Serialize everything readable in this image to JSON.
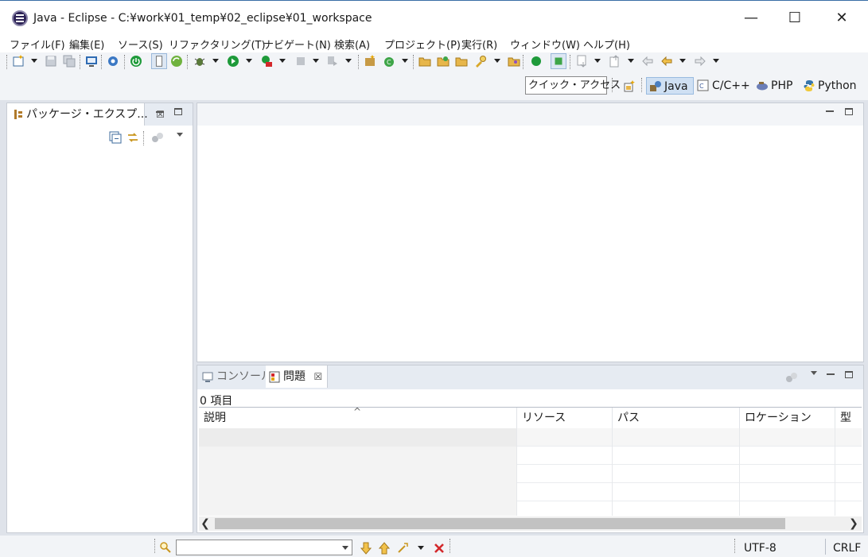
{
  "window": {
    "title": "Java - Eclipse - C:¥work¥01_temp¥02_eclipse¥01_workspace",
    "minimize_glyph": "—",
    "maximize_glyph": "☐",
    "close_glyph": "✕"
  },
  "menu": [
    "ファイル(F)",
    "編集(E)",
    "ソース(S)",
    "リファクタリング(T)",
    "ナビゲート(N)",
    "検索(A)",
    "プロジェクト(P)",
    "実行(R)",
    "ウィンドウ(W)",
    "ヘルプ(H)"
  ],
  "quick_access": {
    "label": "クイック・アクセス"
  },
  "perspectives": [
    {
      "label": "Java",
      "icon": "java-perspective-icon",
      "active": true
    },
    {
      "label": "C/C++",
      "icon": "cpp-perspective-icon",
      "active": false
    },
    {
      "label": "PHP",
      "icon": "php-perspective-icon",
      "active": false
    },
    {
      "label": "Python",
      "icon": "python-perspective-icon",
      "active": false
    }
  ],
  "left_view": {
    "tab_label": "パッケージ・エクスプ...",
    "close_glyph": "☒"
  },
  "bottom_view": {
    "tabs": [
      {
        "label": "コンソール",
        "active": false
      },
      {
        "label": "問題",
        "active": true
      }
    ],
    "close_glyph": "☒",
    "item_count": "0 項目",
    "columns": [
      "説明",
      "リソース",
      "パス",
      "ロケーション",
      "型"
    ],
    "sort_indicator": "^"
  },
  "status": {
    "encoding": "UTF-8",
    "line_ending": "CRLF",
    "search_value": ""
  },
  "colors": {
    "accent": "#3a6ea5",
    "active_perspective": "#cfe0f3",
    "chrome": "#f2f4f7",
    "error_red": "#d3282b",
    "run_green": "#1e9a3a"
  }
}
